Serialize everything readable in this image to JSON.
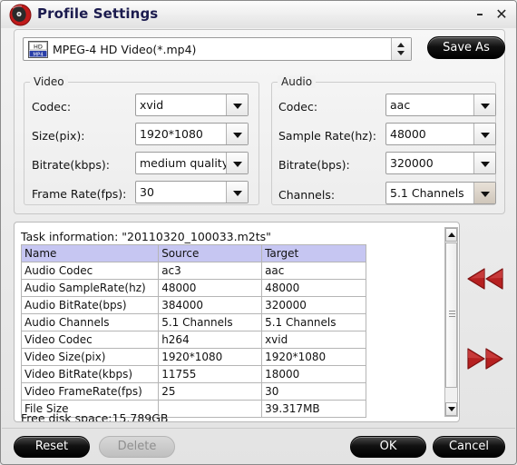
{
  "window": {
    "title": "Profile Settings",
    "icon": "disc-icon",
    "minimize_label": "–",
    "close_label": "✕"
  },
  "profile": {
    "format_icon": "hd-mp4-icon",
    "selected": "MPEG-4 HD Video(*.mp4)",
    "spinner_icon": "spinner-updown-icon",
    "save_as_label": "Save As"
  },
  "video": {
    "legend": "Video",
    "fields": [
      {
        "label": "Codec:",
        "value": "xvid"
      },
      {
        "label": "Size(pix):",
        "value": "1920*1080"
      },
      {
        "label": "Bitrate(kbps):",
        "value": "medium quality"
      },
      {
        "label": "Frame Rate(fps):",
        "value": "30"
      }
    ]
  },
  "audio": {
    "legend": "Audio",
    "fields": [
      {
        "label": "Codec:",
        "value": "aac"
      },
      {
        "label": "Sample Rate(hz):",
        "value": "48000"
      },
      {
        "label": "Bitrate(bps):",
        "value": "320000"
      },
      {
        "label": "Channels:",
        "value": "5.1 Channels"
      }
    ]
  },
  "task": {
    "title": "Task information: \"20110320_100033.m2ts\"",
    "columns": [
      "Name",
      "Source",
      "Target"
    ],
    "rows": [
      [
        "Audio Codec",
        "ac3",
        "aac"
      ],
      [
        "Audio SampleRate(hz)",
        "48000",
        "48000"
      ],
      [
        "Audio BitRate(bps)",
        "384000",
        "320000"
      ],
      [
        "Audio Channels",
        "5.1 Channels",
        "5.1 Channels"
      ],
      [
        "Video Codec",
        "h264",
        "xvid"
      ],
      [
        "Video Size(pix)",
        "1920*1080",
        "1920*1080"
      ],
      [
        "Video BitRate(kbps)",
        "11755",
        "18000"
      ],
      [
        "Video FrameRate(fps)",
        "25",
        "30"
      ],
      [
        "File Size",
        "",
        "39.317MB"
      ]
    ],
    "free_disk_space": "Free disk space:15.789GB",
    "scrollbar": {
      "up_icon": "scroll-up-arrow-icon",
      "down_icon": "scroll-down-arrow-icon",
      "thumb": "scroll-thumb"
    }
  },
  "transport": {
    "back_icon": "rewind-double-arrow-icon",
    "forward_icon": "forward-double-arrow-icon"
  },
  "footer": {
    "reset_label": "Reset",
    "delete_label": "Delete",
    "ok_label": "OK",
    "cancel_label": "Cancel"
  },
  "colors": {
    "table_header": "#c6c6f2",
    "accent_red": "#b62020",
    "title_text": "#1b1b4e"
  }
}
